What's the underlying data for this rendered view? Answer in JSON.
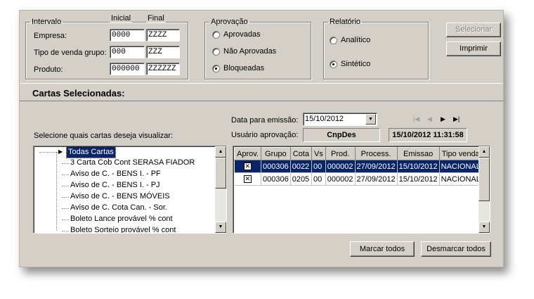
{
  "intervalo": {
    "legend": "Intervalo",
    "inicial_header": "Inicial",
    "final_header": "Final",
    "rows": [
      {
        "label": "Empresa:",
        "inicial": "0000",
        "final": "ZZZZ"
      },
      {
        "label": "Tipo de venda grupo:",
        "inicial": "000",
        "final": "ZZZ"
      },
      {
        "label": "Produto:",
        "inicial": "000000",
        "final": "ZZZZZZ"
      }
    ]
  },
  "aprovacao": {
    "legend": "Aprovação",
    "options": [
      {
        "label": "Aprovadas",
        "selected": false
      },
      {
        "label": "Não Aprovadas",
        "selected": false
      },
      {
        "label": "Bloqueadas",
        "selected": true
      }
    ]
  },
  "relatorio": {
    "legend": "Relatório",
    "options": [
      {
        "label": "Analítico",
        "selected": false
      },
      {
        "label": "Sintético",
        "selected": true
      }
    ]
  },
  "buttons": {
    "selecionar": "Selecionar",
    "imprimir": "Imprimir",
    "marcar_todos": "Marcar todos",
    "desmarcar_todos": "Desmarcar todos"
  },
  "cartas": {
    "title": "Cartas Selecionadas:",
    "instruction": "Selecione quais cartas deseja visualizar:",
    "tree_items": [
      "Todas Cartas",
      "3 Carta Cob Cont SERASA FIADOR",
      "Aviso de C. - BENS I. - PF",
      "Aviso de C. - BENS I. - PJ",
      "Aviso de C. - BENS MÓVEIS",
      "Aviso de C. Cota Can. - Sor.",
      "Boleto Lance provável % cont",
      "Boleto Sorteio provável % cont"
    ]
  },
  "emissao": {
    "data_label": "Data para emissão:",
    "data_value": "15/10/2012",
    "usuario_label": "Usuário aprovação:",
    "usuario_value": "CnpDes",
    "timestamp": "15/10/2012 11:31:58"
  },
  "grid": {
    "headers": [
      "Aprov.",
      "Grupo",
      "Cota",
      "Vs",
      "Prod.",
      "Process.",
      "Emissao",
      "Tipo venda"
    ],
    "rows": [
      {
        "checked": true,
        "grupo": "000306",
        "cota": "0022",
        "vs": "00",
        "prod": "000002",
        "process": "27/09/2012",
        "emissao": "15/10/2012",
        "tipo": "NACIONAL"
      },
      {
        "checked": true,
        "grupo": "000306",
        "cota": "0205",
        "vs": "00",
        "prod": "000002",
        "process": "27/09/2012",
        "emissao": "15/10/2012",
        "tipo": "NACIONAL"
      }
    ]
  },
  "colors": {
    "window_bg": "#d4d0c8",
    "selection": "#0a246a"
  }
}
